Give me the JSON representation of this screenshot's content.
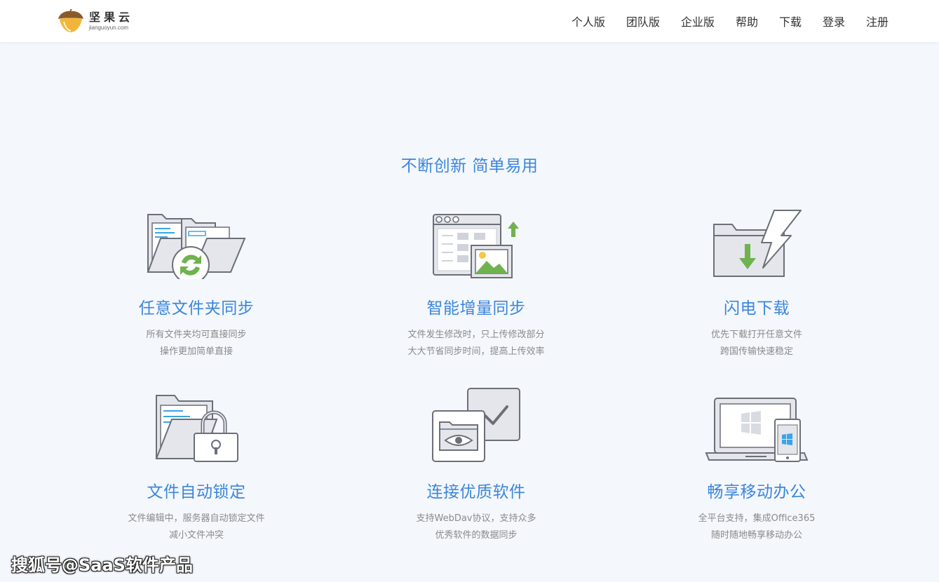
{
  "header": {
    "logo_cn": "坚果云",
    "logo_en": "jianguoyun.com",
    "nav": [
      "个人版",
      "团队版",
      "企业版",
      "帮助",
      "下载",
      "登录",
      "注册"
    ]
  },
  "section": {
    "title": "不断创新 简单易用"
  },
  "features": [
    {
      "title": "任意文件夹同步",
      "desc1": "所有文件夹均可直接同步",
      "desc2": "操作更加简单直接",
      "icon": "folder-sync-icon"
    },
    {
      "title": "智能增量同步",
      "desc1": "文件发生修改时，只上传修改部分",
      "desc2": "大大节省同步时间，提高上传效率",
      "icon": "window-image-upload-icon"
    },
    {
      "title": "闪电下载",
      "desc1": "优先下载打开任意文件",
      "desc2": "跨国传输快速稳定",
      "icon": "folder-lightning-download-icon"
    },
    {
      "title": "文件自动锁定",
      "desc1": "文件编辑中，服务器自动锁定文件",
      "desc2": "减小文件冲突",
      "icon": "folder-lock-icon"
    },
    {
      "title": "连接优质软件",
      "desc1": "支持WebDav协议，支持众多",
      "desc2": "优秀软件的数据同步",
      "icon": "folder-eye-check-icon"
    },
    {
      "title": "畅享移动办公",
      "desc1": "全平台支持，集成Office365",
      "desc2": "随时随地畅享移动办公",
      "icon": "laptop-phone-windows-icon"
    }
  ],
  "watermark": "搜狐号@SaaS软件产品",
  "colors": {
    "accent": "#3b86dc",
    "background": "#f4f7fc",
    "icon_green": "#6fb24f",
    "icon_blue": "#3aa4e6"
  }
}
